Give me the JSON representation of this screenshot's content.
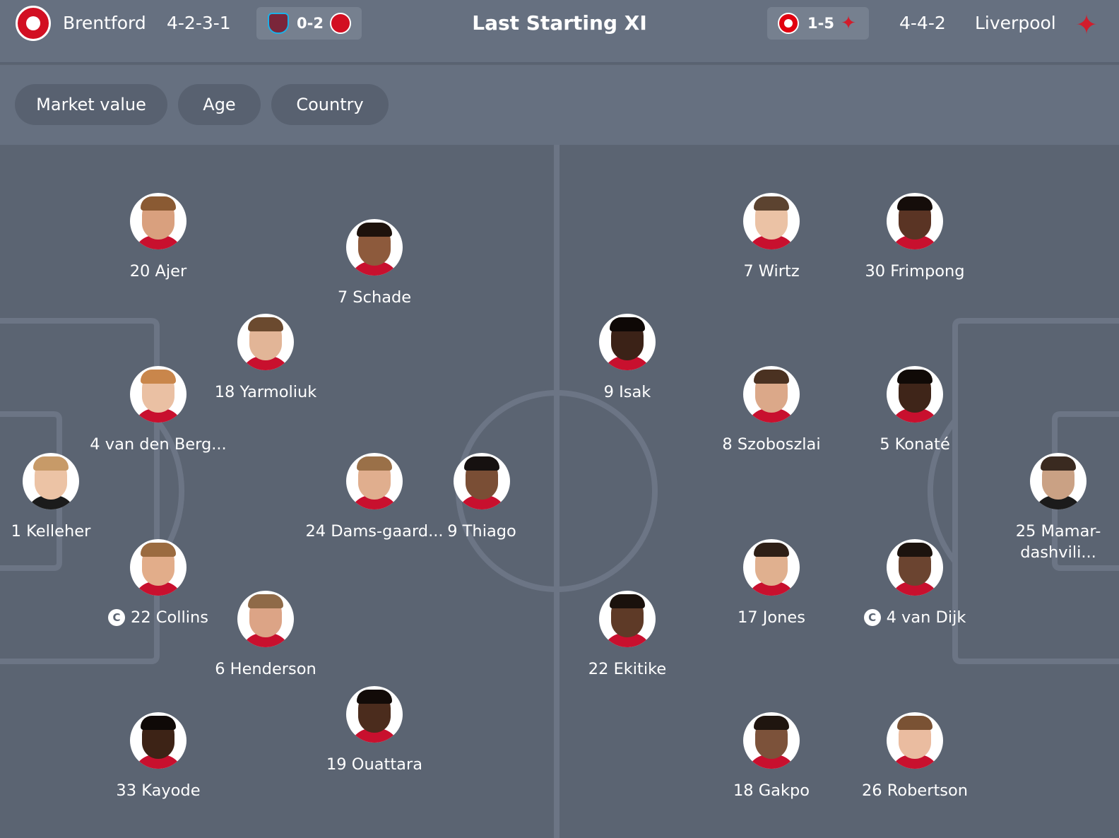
{
  "header": {
    "title": "Last Starting XI",
    "home": {
      "name": "Brentford",
      "formation": "4-2-3-1",
      "crest_icon": "brentford-crest-icon",
      "last_fixture": {
        "score": "0-2",
        "left_icon": "west-ham-crest-icon",
        "right_icon": "brentford-crest-icon"
      }
    },
    "away": {
      "name": "Liverpool",
      "formation": "4-4-2",
      "crest_icon": "liverpool-crest-icon",
      "last_fixture": {
        "score": "1-5",
        "left_icon": "eintracht-frankfurt-crest-icon",
        "right_icon": "liverpool-crest-icon"
      }
    }
  },
  "filters": {
    "market_value": "Market value",
    "age": "Age",
    "country": "Country"
  },
  "lineups": {
    "home": [
      {
        "label": "20 Ajer",
        "skin": "#d9a07e",
        "hair": "#8a5a33",
        "shirt": "#c8102e"
      },
      {
        "label": "7 Schade",
        "skin": "#8d5a3c",
        "hair": "#1d120c",
        "shirt": "#c8102e"
      },
      {
        "label": "18 Yarmoliuk",
        "skin": "#e2b597",
        "hair": "#6b4a2f",
        "shirt": "#c8102e"
      },
      {
        "label": "4 van den Berg...",
        "skin": "#eac0a3",
        "hair": "#c9864b",
        "shirt": "#c8102e"
      },
      {
        "label": "1 Kelleher",
        "skin": "#ecc3a5",
        "hair": "#c79a68",
        "shirt": "#1b1b1b"
      },
      {
        "label": "24 Dams-gaard...",
        "skin": "#e0ae8e",
        "hair": "#9a7048",
        "shirt": "#c8102e"
      },
      {
        "label": "9 Thiago",
        "skin": "#7a4e35",
        "hair": "#161110",
        "shirt": "#c8102e"
      },
      {
        "label": "22 Collins",
        "skin": "#e2ad8a",
        "hair": "#9b6b40",
        "shirt": "#c8102e",
        "captain": true,
        "captain_mark": "C"
      },
      {
        "label": "6 Henderson",
        "skin": "#dca486",
        "hair": "#8f6a48",
        "shirt": "#c8102e"
      },
      {
        "label": "19 Ouattara",
        "skin": "#4b2c1d",
        "hair": "#120b08",
        "shirt": "#c8102e"
      },
      {
        "label": "33 Kayode",
        "skin": "#3d2316",
        "hair": "#0f0907",
        "shirt": "#c8102e"
      }
    ],
    "away": [
      {
        "label": "7 Wirtz",
        "skin": "#ebc2a5",
        "hair": "#5c4330",
        "shirt": "#c8102e"
      },
      {
        "label": "30 Frimpong",
        "skin": "#5a3424",
        "hair": "#150d0a",
        "shirt": "#c8102e"
      },
      {
        "label": "9 Isak",
        "skin": "#3b2217",
        "hair": "#0e0806",
        "shirt": "#c8102e"
      },
      {
        "label": "8 Szoboszlai",
        "skin": "#dba889",
        "hair": "#4a3121",
        "shirt": "#c8102e"
      },
      {
        "label": "5 Konaté",
        "skin": "#3f2519",
        "hair": "#100a07",
        "shirt": "#c8102e"
      },
      {
        "label": "25 Mamar-dashvili...",
        "skin": "#caa184",
        "hair": "#3a2a20",
        "shirt": "#1b1b1b"
      },
      {
        "label": "17 Jones",
        "skin": "#e0b08f",
        "hair": "#2e1f16",
        "shirt": "#c8102e"
      },
      {
        "label": "22 Ekitike",
        "skin": "#5e3a27",
        "hair": "#1a110c",
        "shirt": "#c8102e"
      },
      {
        "label": "4 van Dijk",
        "skin": "#6b4430",
        "hair": "#1c130e",
        "shirt": "#c8102e",
        "captain": true,
        "captain_mark": "C"
      },
      {
        "label": "18 Gakpo",
        "skin": "#7c523a",
        "hair": "#1f150f",
        "shirt": "#c8102e"
      },
      {
        "label": "26 Robertson",
        "skin": "#eabca0",
        "hair": "#7a5234",
        "shirt": "#c8102e"
      }
    ]
  },
  "colors": {
    "pitch": "#5b6472",
    "header": "#667080",
    "lines": "#6c7585",
    "brentford_red": "#d20f22",
    "liverpool_red": "#d21c2b"
  }
}
